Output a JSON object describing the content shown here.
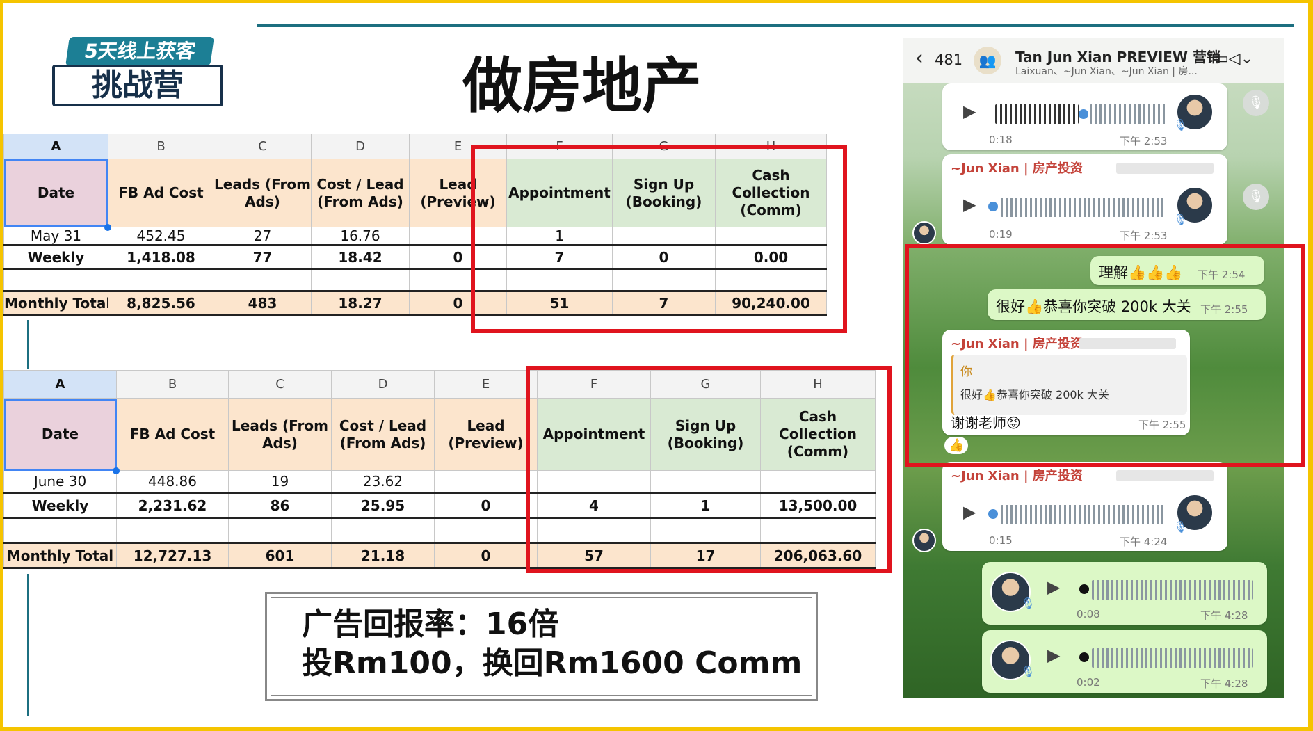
{
  "logo": {
    "line1": "5天线上获客",
    "line2": "挑战营"
  },
  "title": "做房地产",
  "col_letters": [
    "A",
    "B",
    "C",
    "D",
    "E",
    "F",
    "G",
    "H"
  ],
  "headers": [
    "Date",
    "FB Ad Cost",
    "Leads (From Ads)",
    "Cost / Lead (From Ads)",
    "Lead (Preview)",
    "Appointment",
    "Sign Up (Booking)",
    "Cash Collection (Comm)"
  ],
  "sheet1": {
    "prev_row": [
      "May 31",
      "452.45",
      "27",
      "16.76",
      "",
      "1",
      "",
      ""
    ],
    "weekly": [
      "Weekly",
      "1,418.08",
      "77",
      "18.42",
      "0",
      "7",
      "0",
      "0.00"
    ],
    "total": [
      "Monthly Total",
      "8,825.56",
      "483",
      "18.27",
      "0",
      "51",
      "7",
      "90,240.00"
    ]
  },
  "sheet2": {
    "prev_row": [
      "June 30",
      "448.86",
      "19",
      "23.62",
      "",
      "",
      "",
      ""
    ],
    "weekly": [
      "Weekly",
      "2,231.62",
      "86",
      "25.95",
      "0",
      "4",
      "1",
      "13,500.00"
    ],
    "total": [
      "Monthly Total",
      "12,727.13",
      "601",
      "21.18",
      "0",
      "57",
      "17",
      "206,063.60"
    ]
  },
  "caption": {
    "line1": "广告回报率：16倍",
    "line2": "投Rm100，换回Rm1600 Comm"
  },
  "chat": {
    "back_count": "481",
    "group_name": "Tan Jun Xian PREVIEW 营销",
    "group_members": "Laixuan、~Jun Xian、~Jun Xian | 房...",
    "sender": "~Jun Xian | 房产投资",
    "voice1": {
      "duration": "0:18",
      "time": "下午 2:53"
    },
    "voice2": {
      "duration": "0:19",
      "time": "下午 2:53"
    },
    "msg1": {
      "text": "理解👍👍👍",
      "time": "下午 2:54"
    },
    "msg2": {
      "text": "很好👍恭喜你突破 200k 大关",
      "time": "下午 2:55"
    },
    "reply": {
      "quote_author": "你",
      "quote_text": "很好👍恭喜你突破 200k 大关",
      "text": "谢谢老师😝",
      "time": "下午 2:55",
      "reaction": "👍"
    },
    "voice3": {
      "duration": "0:15",
      "time": "下午 4:24"
    },
    "voice4": {
      "duration": "0:08",
      "time": "下午 4:28"
    },
    "voice5": {
      "duration": "0:02",
      "time": "下午 4:28"
    }
  }
}
